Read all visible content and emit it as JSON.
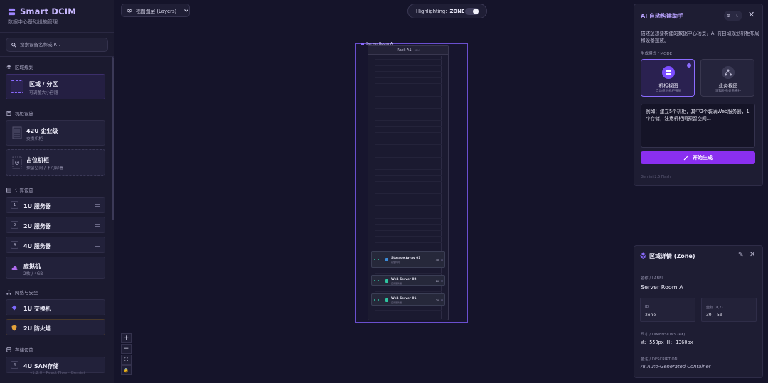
{
  "sidebar": {
    "brand_title": "Smart DCIM",
    "brand_subtitle": "数据中心基础设施管理",
    "search_placeholder": "搜索设备名称或IP...",
    "version": "v1.2.0 · React Flow · Gemini",
    "sections": {
      "zone": "区域规划",
      "cabinet": "机柜设施",
      "compute": "计算设施",
      "network": "网络与安全",
      "storage": "存储设施"
    },
    "zone_card": {
      "title": "区域 / 分区",
      "subtitle": "可调整大小容器"
    },
    "rack_card": {
      "title": "42U 企业级",
      "subtitle": "交换机柜"
    },
    "placeholder_card": {
      "title": "占位机柜",
      "subtitle": "预留空间 / 不可部署"
    },
    "compute_items": [
      {
        "num": "1",
        "label": "1U 服务器"
      },
      {
        "num": "2",
        "label": "2U 服务器"
      },
      {
        "num": "4",
        "label": "4U 服务器"
      }
    ],
    "vm_card": {
      "title": "虚拟机",
      "subtitle": "2核 / 4GB"
    },
    "switch_label": "1U 交换机",
    "firewall_label": "2U 防火墙",
    "storage_item": "4U SAN存储"
  },
  "canvas": {
    "view_button": "视图图层 (Layers)",
    "highlight_label": "Highlighting:",
    "highlight_value": "ZONE",
    "highlight_on": false,
    "zone_label": "Server Room A",
    "rack_title": "Rack A1",
    "rack_subtitle": "42U",
    "devices": [
      {
        "name": "Storage Array 01",
        "sub": "存储阵列",
        "u": "4U",
        "color": "#3b8bd8"
      },
      {
        "name": "Web Server 02",
        "sub": "应用服务器",
        "u": "2U",
        "color": "#2ec4a0"
      },
      {
        "name": "Web Server 01",
        "sub": "应用服务器",
        "u": "2U",
        "color": "#2ec4a0"
      }
    ],
    "zoom_controls": [
      "+",
      "−",
      "⛶",
      "🔒"
    ]
  },
  "ai_panel": {
    "title": "AI 自动构建助手",
    "description": "描述您想要构建的数据中心场景，AI 将自动规划机柜布局和设备摆放。",
    "mode_label": "生成模式 / MODE",
    "modes": [
      {
        "title": "机柜视图",
        "subtitle": "自动规划机柜布局",
        "selected": true
      },
      {
        "title": "业务视图",
        "subtitle": "逻辑业务关系拓扑",
        "selected": false
      }
    ],
    "prompt": "例如：建立5个机柜，其中2个装满Web服务器，1\n个存储，注意机柜间预留空间...",
    "generate_label": "开始生成",
    "footer": "Gemini 2.5 Flash"
  },
  "zone_panel": {
    "title": "区域详情 (Zone)",
    "label_caption": "名称 / LABEL",
    "label_value": "Server Room A",
    "id_caption": "ID",
    "id_value": "zone",
    "coord_caption": "坐标 (X,Y)",
    "coord_value": "30, 50",
    "dims_caption": "尺寸 / DIMENSIONS (PX)",
    "dims_value": "W: 550px  H: 1360px",
    "desc_caption": "备注 / DESCRIPTION",
    "desc_value": "AI Auto-Generated Container"
  },
  "colors": {
    "accent": "#8a2ff0",
    "zone_border": "#6a4fcf",
    "brand": "#c8b8ff"
  }
}
